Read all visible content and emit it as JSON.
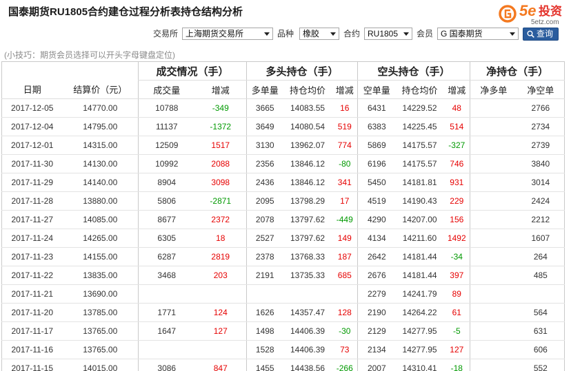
{
  "page": {
    "title": "国泰期货RU1805合约建仓过程分析表持仓结构分析"
  },
  "logo": {
    "mark": "5e",
    "name": "投资",
    "domain": "5etz.com",
    "icon": "logo-icon"
  },
  "filters": {
    "exchange": {
      "label": "交易所",
      "value": "上海期货交易所"
    },
    "product": {
      "label": "品种",
      "value": "橡胶"
    },
    "contract": {
      "label": "合约",
      "value": "RU1805"
    },
    "member": {
      "label": "会员",
      "value": "G 国泰期货"
    },
    "query_button": {
      "label": "查询",
      "icon": "search-icon"
    }
  },
  "tip": "(小技巧：期货会员选择可以开头字母键盘定位)",
  "table": {
    "groups": [
      "成交情况（手）",
      "多头持仓（手）",
      "空头持仓（手）",
      "净持仓（手）"
    ],
    "columns": [
      "日期",
      "结算价（元）",
      "成交量",
      "增减",
      "多单量",
      "持仓均价",
      "增减",
      "空单量",
      "持仓均价",
      "增减",
      "净多单",
      "净空单"
    ],
    "rows": [
      [
        "2017-12-05",
        "14770.00",
        "10788",
        "-349",
        "3665",
        "14083.55",
        "16",
        "6431",
        "14229.52",
        "48",
        "",
        "2766"
      ],
      [
        "2017-12-04",
        "14795.00",
        "11137",
        "-1372",
        "3649",
        "14080.54",
        "519",
        "6383",
        "14225.45",
        "514",
        "",
        "2734"
      ],
      [
        "2017-12-01",
        "14315.00",
        "12509",
        "1517",
        "3130",
        "13962.07",
        "774",
        "5869",
        "14175.57",
        "-327",
        "",
        "2739"
      ],
      [
        "2017-11-30",
        "14130.00",
        "10992",
        "2088",
        "2356",
        "13846.12",
        "-80",
        "6196",
        "14175.57",
        "746",
        "",
        "3840"
      ],
      [
        "2017-11-29",
        "14140.00",
        "8904",
        "3098",
        "2436",
        "13846.12",
        "341",
        "5450",
        "14181.81",
        "931",
        "",
        "3014"
      ],
      [
        "2017-11-28",
        "13880.00",
        "5806",
        "-2871",
        "2095",
        "13798.29",
        "17",
        "4519",
        "14190.43",
        "229",
        "",
        "2424"
      ],
      [
        "2017-11-27",
        "14085.00",
        "8677",
        "2372",
        "2078",
        "13797.62",
        "-449",
        "4290",
        "14207.00",
        "156",
        "",
        "2212"
      ],
      [
        "2017-11-24",
        "14265.00",
        "6305",
        "18",
        "2527",
        "13797.62",
        "149",
        "4134",
        "14211.60",
        "1492",
        "",
        "1607"
      ],
      [
        "2017-11-23",
        "14155.00",
        "6287",
        "2819",
        "2378",
        "13768.33",
        "187",
        "2642",
        "14181.44",
        "-34",
        "",
        "264"
      ],
      [
        "2017-11-22",
        "13835.00",
        "3468",
        "203",
        "2191",
        "13735.33",
        "685",
        "2676",
        "14181.44",
        "397",
        "",
        "485"
      ],
      [
        "2017-11-21",
        "13690.00",
        "",
        "",
        "",
        "",
        "",
        "2279",
        "14241.79",
        "89",
        "",
        ""
      ],
      [
        "2017-11-20",
        "13785.00",
        "1771",
        "124",
        "1626",
        "14357.47",
        "128",
        "2190",
        "14264.22",
        "61",
        "",
        "564"
      ],
      [
        "2017-11-17",
        "13765.00",
        "1647",
        "127",
        "1498",
        "14406.39",
        "-30",
        "2129",
        "14277.95",
        "-5",
        "",
        "631"
      ],
      [
        "2017-11-16",
        "13765.00",
        "",
        "",
        "1528",
        "14406.39",
        "73",
        "2134",
        "14277.95",
        "127",
        "",
        "606"
      ],
      [
        "2017-11-15",
        "14015.00",
        "3086",
        "847",
        "1455",
        "14438.56",
        "-266",
        "2007",
        "14310.41",
        "-18",
        "",
        "552"
      ]
    ]
  },
  "colors": {
    "up": "#e60000",
    "down": "#009900",
    "button": "#2b5d9e",
    "logo_orange": "#f47920",
    "logo_red": "#e4322b"
  }
}
